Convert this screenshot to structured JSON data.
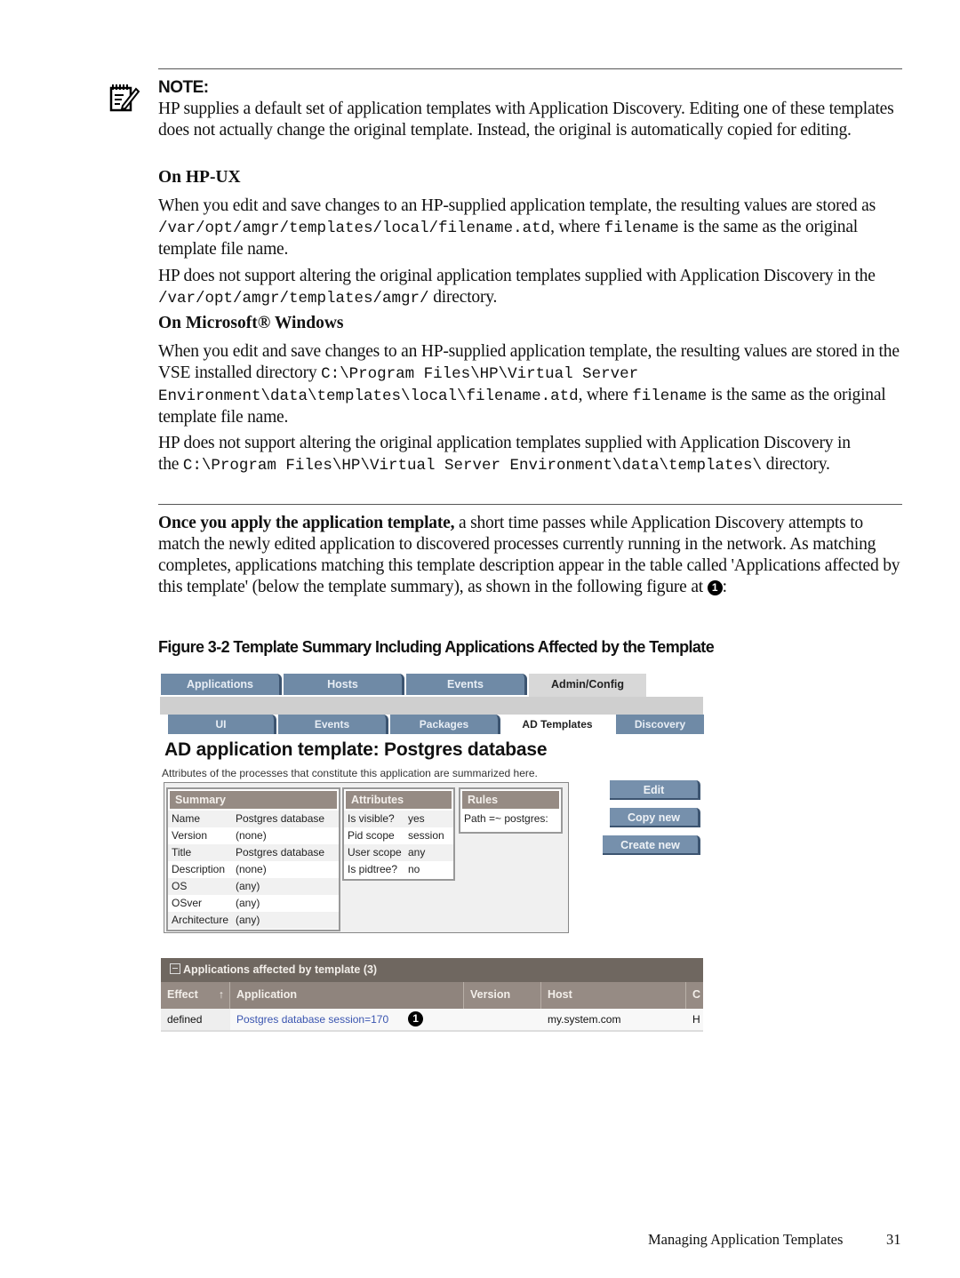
{
  "note": {
    "icon": "note-pencil-icon",
    "title": "NOTE:",
    "intro": "HP supplies a default set of application templates with Application Discovery. Editing one of these templates does not actually change the original template. Instead, the original is automatically copied for editing.",
    "hpux": {
      "heading": "On HP-UX",
      "p1_a": "When you edit and save changes to an HP-supplied application template, the resulting values are stored as ",
      "p1_code1": "/var/opt/amgr/templates/local/filename.atd",
      "p1_b": ", where ",
      "p1_code2": "filename",
      "p1_c": " is the same as the original template file name.",
      "p2_a": "HP does not support altering the original application templates supplied with Application Discovery in the ",
      "p2_code": "/var/opt/amgr/templates/amgr/",
      "p2_b": " directory."
    },
    "windows": {
      "heading": "On Microsoft® Windows",
      "p1_a": "When you edit and save changes to an HP-supplied application template, the resulting values are stored in the VSE installed directory ",
      "p1_code1": "C:\\Program Files\\HP\\Virtual Server Environment\\data\\templates\\local\\filename.atd",
      "p1_b": ", where ",
      "p1_code2": "filename",
      "p1_c": " is the same as the original template file name.",
      "p2_a": "HP does not support altering the original application templates supplied with Application Discovery in the ",
      "p2_code": "C:\\Program Files\\HP\\Virtual Server Environment\\data\\templates\\",
      "p2_b": " directory."
    }
  },
  "body": {
    "lead_bold": "Once you apply the application template,",
    "lead_rest": " a short time passes while Application Discovery attempts to match the newly edited application to discovered processes currently running in the network. As matching completes, applications matching this template description appear in the table called 'Applications affected by this template' (below the template summary), as shown in the following figure at ",
    "callout": "1",
    "lead_end": ":"
  },
  "figure": {
    "caption": "Figure  3-2  Template Summary Including Applications Affected by the Template",
    "screenshot": {
      "tabs": [
        "Applications",
        "Hosts",
        "Events",
        "Admin/Config"
      ],
      "active_tab": "Admin/Config",
      "subtabs": [
        "UI",
        "Events",
        "Packages",
        "AD Templates",
        "Discovery"
      ],
      "active_subtab": "AD Templates",
      "title": "AD application template: Postgres database",
      "subtitle": "Attributes of the processes that constitute this application are summarized here.",
      "summary": {
        "heading": "Summary",
        "rows": [
          {
            "k": "Name",
            "v": "Postgres database"
          },
          {
            "k": "Version",
            "v": "(none)"
          },
          {
            "k": "Title",
            "v": "Postgres database"
          },
          {
            "k": "Description",
            "v": "(none)"
          },
          {
            "k": "OS",
            "v": "(any)"
          },
          {
            "k": "OSver",
            "v": "(any)"
          },
          {
            "k": "Architecture",
            "v": "(any)"
          }
        ]
      },
      "attributes": {
        "heading": "Attributes",
        "rows": [
          {
            "k": "Is visible?",
            "v": "yes"
          },
          {
            "k": "Pid scope",
            "v": "session"
          },
          {
            "k": "User scope",
            "v": "any"
          },
          {
            "k": "Is pidtree?",
            "v": "no"
          }
        ]
      },
      "rules": {
        "heading": "Rules",
        "value": "Path =~ postgres:"
      },
      "buttons": {
        "edit": "Edit",
        "copy_new": "Copy new",
        "create_new": "Create new"
      },
      "apps": {
        "heading": "Applications affected by template (3)",
        "columns": [
          "Effect",
          "Application",
          "Version",
          "Host",
          "C"
        ],
        "sort_icon": "↑",
        "rows": [
          {
            "effect": "defined",
            "application": "Postgres database session=170",
            "callout": "1",
            "version": "",
            "host": "my.system.com",
            "extra": "H"
          }
        ]
      }
    }
  },
  "footer": {
    "chapter": "Managing Application Templates",
    "page": "31"
  }
}
